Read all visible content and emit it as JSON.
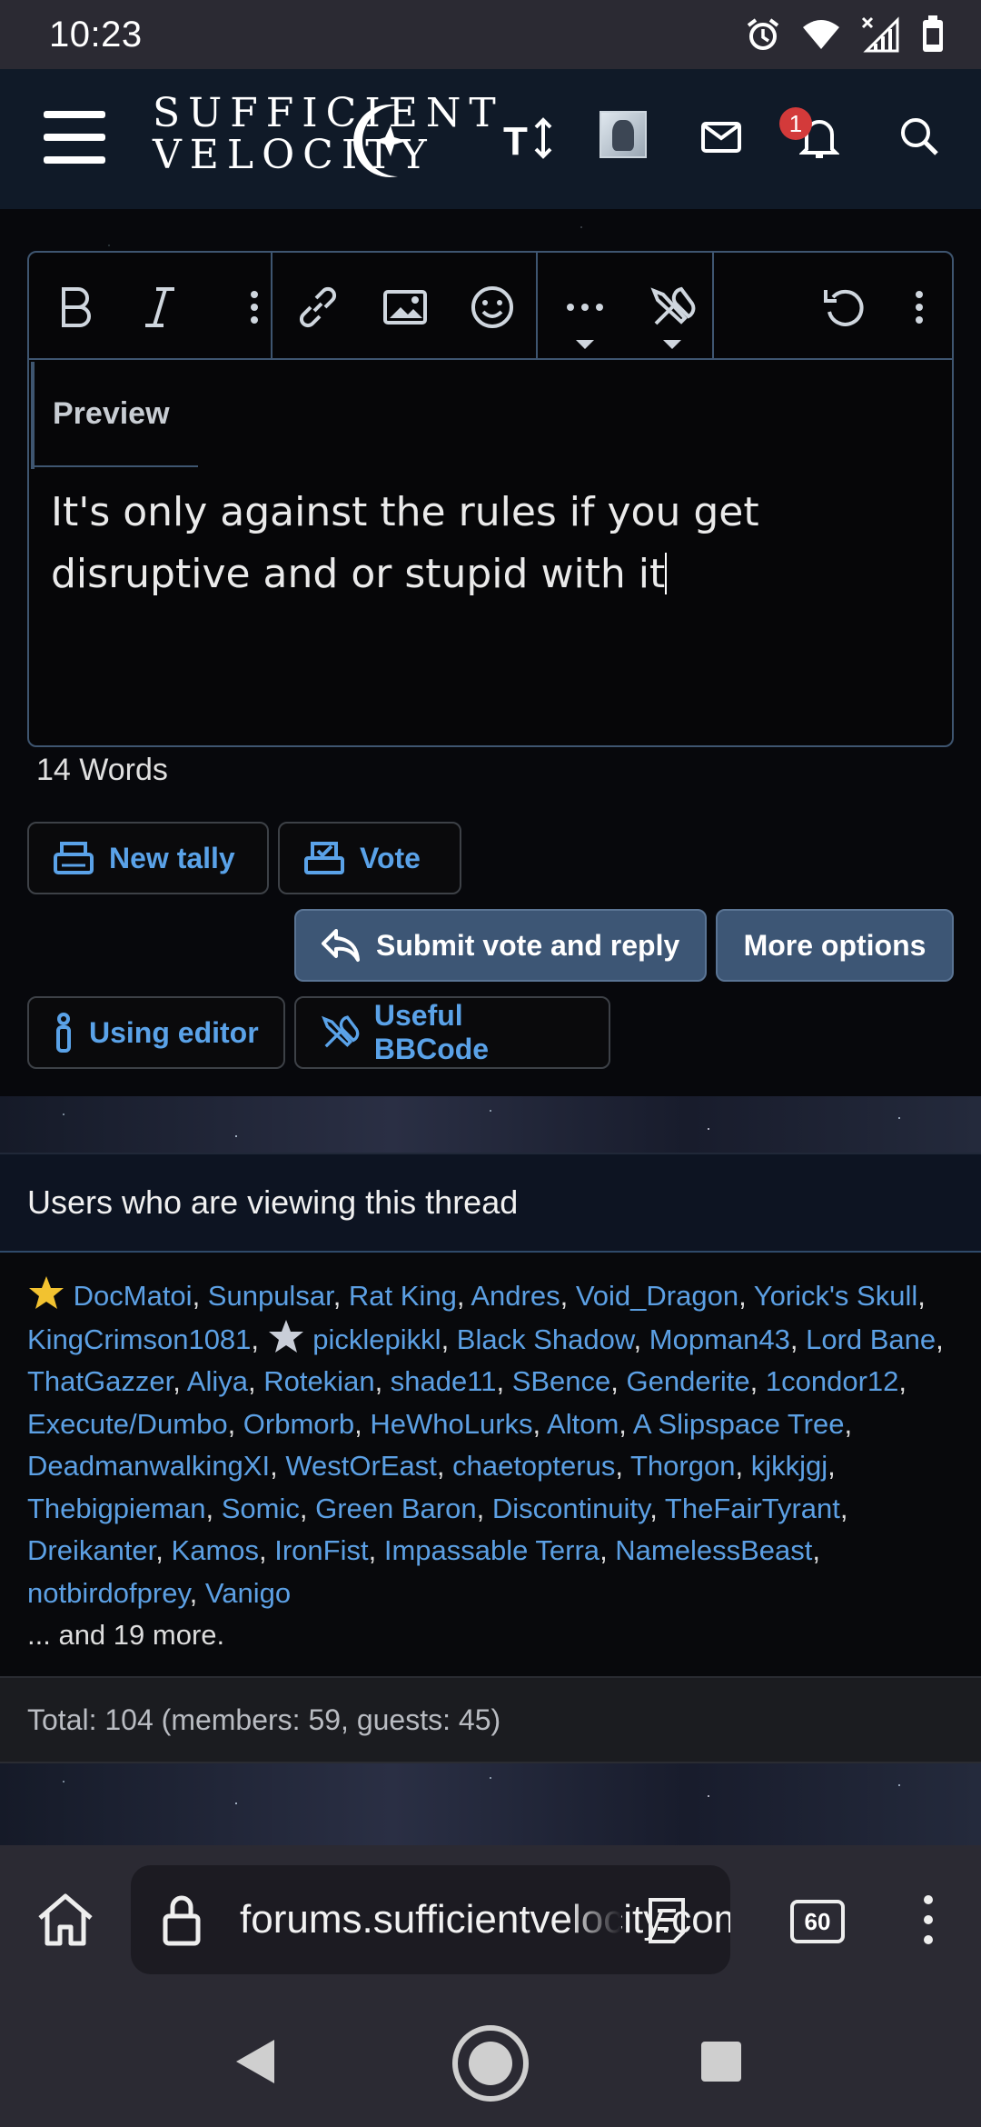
{
  "status_bar": {
    "time": "10:23",
    "icons": [
      "alarm-icon",
      "wifi-icon",
      "signal-icon",
      "battery-icon"
    ]
  },
  "header": {
    "logo_line1": "SUFFICIENT",
    "logo_line2": "VELOCITY",
    "notification_count": "1",
    "icons": [
      "menu-icon",
      "text-size-icon",
      "avatar",
      "mail-icon",
      "bell-icon",
      "search-icon"
    ]
  },
  "editor": {
    "toolbar": [
      "bold-icon",
      "italic-icon",
      "more-vertical-icon",
      "link-icon",
      "image-icon",
      "emoji-icon",
      "more-horizontal-icon",
      "tools-icon",
      "undo-icon",
      "more-vertical-icon"
    ],
    "preview_tab": "Preview",
    "content": "It's only against the rules if you get disruptive and or stupid with it",
    "word_count": "14 Words"
  },
  "buttons": {
    "new_tally": "New tally",
    "vote": "Vote",
    "submit_vote_reply": "Submit vote and reply",
    "more_options": "More options",
    "using_editor": "Using editor",
    "useful_bbcode": "Useful BBCode"
  },
  "viewers": {
    "title": "Users who are viewing this thread",
    "more": "... and 19 more.",
    "total": "Total: 104 (members: 59, guests: 45)"
  },
  "browser": {
    "url": "forums.sufficientvelocity.com",
    "tab_count": "60"
  },
  "colors": {
    "link": "#5ca0e4",
    "accent_button": "#3d5675",
    "badge": "#d33a3a"
  }
}
